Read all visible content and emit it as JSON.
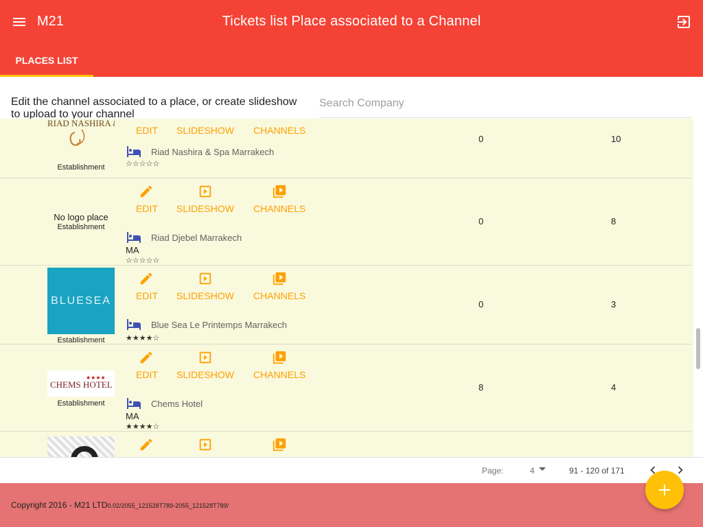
{
  "header": {
    "brand": "M21",
    "title": "Tickets list Place associated to a Channel",
    "menu_icon": "menu-icon",
    "logout_icon": "logout-icon"
  },
  "tabs": [
    {
      "label": "PLACES LIST",
      "active": true
    }
  ],
  "subheader": {
    "description": "Edit the channel associated to a place, or create slideshow to upload to your channel",
    "search_placeholder": "Search Company"
  },
  "actions": {
    "edit": "EDIT",
    "slideshow": "SLIDESHOW",
    "channels": "CHANNELS"
  },
  "rows": [
    {
      "logo_text": "RIAD NASHIRA & SPA",
      "type": "Establishment",
      "name": "Riad Nashira & Spa Marrakech",
      "country": "",
      "stars": "☆☆☆☆☆",
      "col1": "0",
      "col2": "10"
    },
    {
      "logo_text": "No logo place",
      "type": "Establishment",
      "name": "Riad Djebel Marrakech",
      "country": "MA",
      "stars": "☆☆☆☆☆",
      "col1": "0",
      "col2": "8"
    },
    {
      "logo_text": "BLUESEA",
      "type": "Establishment",
      "name": "Blue Sea Le Printemps Marrakech",
      "country": "",
      "stars": "★★★★☆",
      "col1": "0",
      "col2": "3"
    },
    {
      "logo_text": "CHEMS HOTEL",
      "logo_stars": "★★★★",
      "type": "Establishment",
      "name": "Chems Hotel",
      "country": "MA",
      "stars": "★★★★☆",
      "col1": "8",
      "col2": "4"
    }
  ],
  "pagination": {
    "page_label": "Page:",
    "page": "4",
    "range": "91 - 120 of 171"
  },
  "footer": {
    "copyright": "Copyright 2016 - M21 LTD",
    "version": "0.02/2055_121528T789-2055_121528T789/"
  },
  "colors": {
    "primary": "#f44336",
    "accent": "#ffc107",
    "action": "#ffa000",
    "row_bg": "#f9f9dd",
    "footer": "#e57373"
  }
}
